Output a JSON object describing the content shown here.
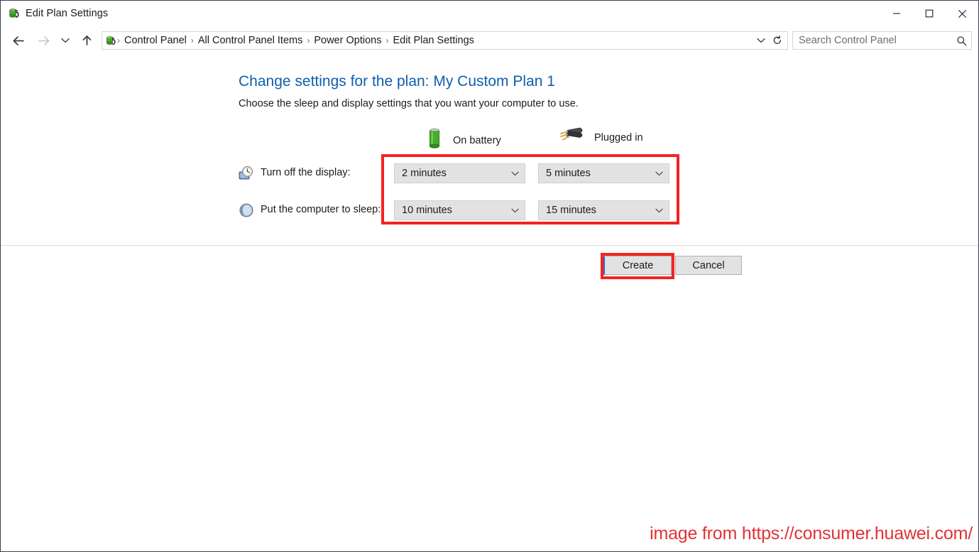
{
  "window": {
    "title": "Edit Plan Settings",
    "title_icon": "power-options-icon",
    "controls": {
      "minimize": "minimize-icon",
      "maximize": "maximize-icon",
      "close": "close-icon"
    }
  },
  "addressbar": {
    "back_icon": "back-arrow-icon",
    "forward_icon": "forward-arrow-icon",
    "history_icon": "chevron-down-icon",
    "up_icon": "up-arrow-icon",
    "breadcrumb_icon": "power-options-icon",
    "breadcrumbs": [
      "Control Panel",
      "All Control Panel Items",
      "Power Options",
      "Edit Plan Settings"
    ],
    "separator": "›",
    "dropdown_icon": "chevron-down-icon",
    "refresh_icon": "refresh-icon",
    "search": {
      "placeholder": "Search Control Panel",
      "value": "",
      "icon": "search-icon"
    }
  },
  "main": {
    "heading": "Change settings for the plan: My Custom Plan 1",
    "subheading": "Choose the sleep and display settings that you want your computer to use.",
    "columns": [
      {
        "label": "On battery",
        "icon": "battery-icon"
      },
      {
        "label": "Plugged in",
        "icon": "power-plug-icon"
      }
    ],
    "rows": [
      {
        "label": "Turn off the display:",
        "icon": "display-clock-icon",
        "on_battery": "2 minutes",
        "plugged_in": "5 minutes"
      },
      {
        "label": "Put the computer to sleep:",
        "icon": "sleep-moon-icon",
        "on_battery": "10 minutes",
        "plugged_in": "15 minutes"
      }
    ],
    "combo_arrow_icon": "chevron-down-icon"
  },
  "footer": {
    "create_label": "Create",
    "cancel_label": "Cancel"
  },
  "annotations": {
    "highlight_color": "#f42222",
    "dropdowns_box": "red-highlight-dropdowns",
    "create_box": "red-highlight-create-button"
  },
  "watermark": {
    "text": "image from https://consumer.huawei.com/",
    "color": "#e23236"
  }
}
